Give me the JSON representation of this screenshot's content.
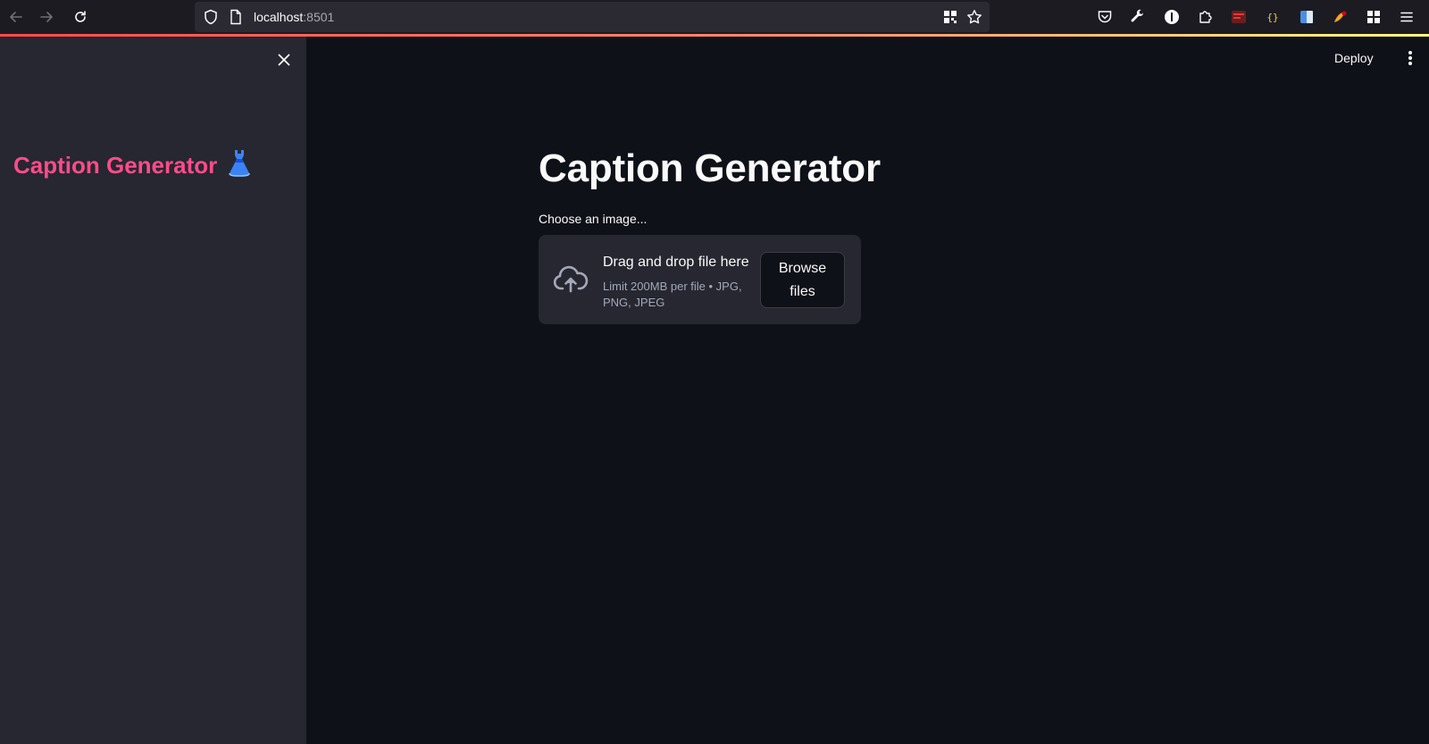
{
  "browser": {
    "url_host": "localhost",
    "url_port": ":8501",
    "icons": [
      "back-arrow-icon",
      "forward-arrow-icon",
      "reload-icon",
      "shield-icon",
      "page-icon",
      "qr-code-icon",
      "bookmark-star-icon",
      "pocket-icon",
      "wrench-icon",
      "info-icon",
      "extensions-puzzle-icon",
      "red-extension-icon",
      "json-extension-icon",
      "blue-extension-icon",
      "colorful-extension-icon",
      "grid-extension-icon",
      "hamburger-menu-icon"
    ],
    "json_ext_text": "{}"
  },
  "sidebar": {
    "title": "Caption Generator",
    "emoji": "👗"
  },
  "header": {
    "deploy_label": "Deploy"
  },
  "main": {
    "title": "Caption Generator",
    "uploader": {
      "label": "Choose an image...",
      "drop_title": "Drag and drop file here",
      "drop_subtitle": "Limit 200MB per file • JPG, PNG, JPEG",
      "browse_label": "Browse files"
    }
  },
  "colors": {
    "accent_gradient_start": "#ff4b4b",
    "accent_gradient_end": "#fffd80",
    "sidebar_title": "#ff4b8b",
    "background": "#0e1117",
    "sidebar_background": "#262730"
  }
}
